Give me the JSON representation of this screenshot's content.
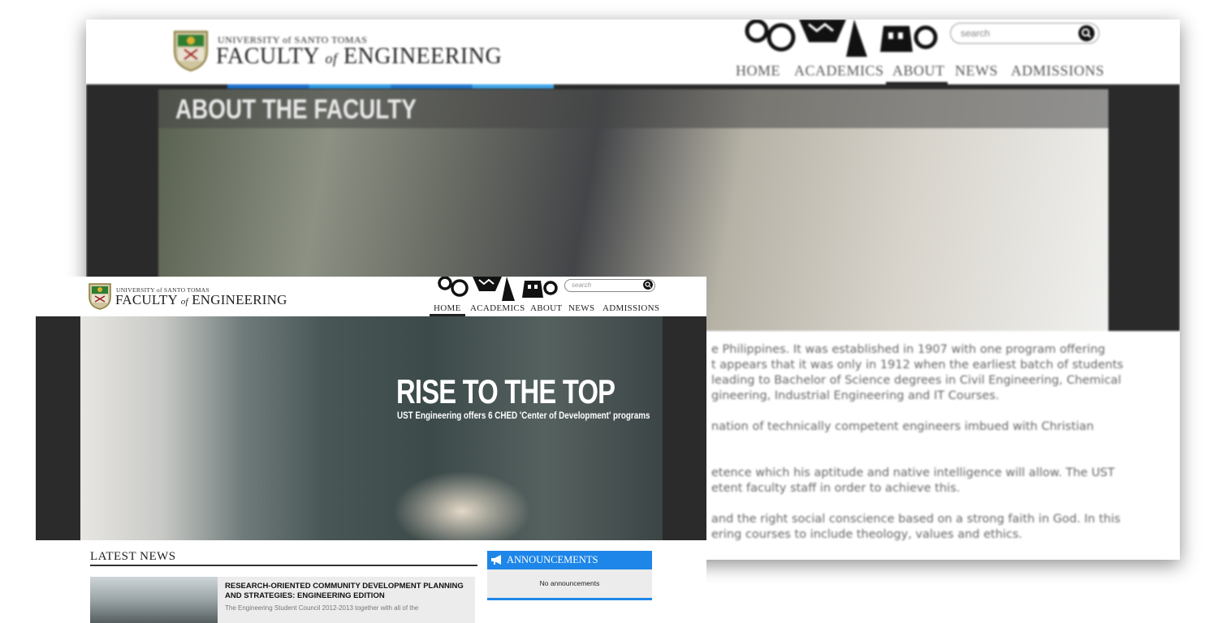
{
  "back_page": {
    "header": {
      "university": "UNIVERSITY of SANTO TOMAS",
      "faculty_prefix": "FACULTY ",
      "faculty_of": "of",
      "faculty_suffix": " ENGINEERING",
      "search_placeholder": "search",
      "nav": [
        "HOME",
        "ACADEMICS",
        "ABOUT",
        "NEWS",
        "ADMISSIONS"
      ],
      "active_nav": "ABOUT"
    },
    "hero_title": "ABOUT THE FACULTY",
    "body_lines": [
      "e Philippines. It was established in 1907 with one program offering",
      "t appears that it was only in 1912 when the earliest batch of students",
      "leading to Bachelor of Science degrees in Civil Engineering, Chemical",
      "gineering, Industrial Engineering and IT Courses.",
      "",
      "nation of technically competent engineers imbued with Christian",
      "",
      "",
      "etence which his aptitude and native intelligence will allow. The UST",
      "etent faculty staff in order to achieve this.",
      "",
      "and the right social conscience based on a strong faith in God. In this",
      "ering courses to include theology, values and ethics."
    ]
  },
  "front_page": {
    "header": {
      "university": "UNIVERSITY of SANTO TOMAS",
      "faculty_prefix": "FACULTY ",
      "faculty_of": "of",
      "faculty_suffix": " ENGINEERING",
      "search_placeholder": "search",
      "nav": [
        "HOME",
        "ACADEMICS",
        "ABOUT",
        "NEWS",
        "ADMISSIONS"
      ],
      "active_nav": "HOME"
    },
    "hero": {
      "headline": "RISE TO THE TOP",
      "subheadline": "UST Engineering offers 6 CHED 'Center of Development' programs"
    },
    "latest_news": {
      "heading": "LATEST NEWS",
      "items": [
        {
          "title": "RESEARCH-ORIENTED COMMUNITY DEVELOPMENT PLANNING AND STRATEGIES: ENGINEERING EDITION",
          "excerpt": "The Engineering Student Council 2012-2013 together with all of the"
        }
      ]
    },
    "announcements": {
      "heading": "ANNOUNCEMENTS",
      "empty_text": "No announcements"
    }
  },
  "colors": {
    "accent_blue": "#1d86e8",
    "dark_bar": "#2b2b2b",
    "nav_text": "#222222"
  }
}
